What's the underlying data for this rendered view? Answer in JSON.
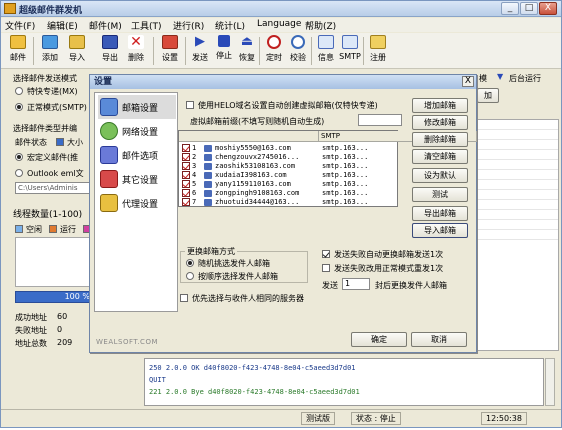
{
  "window": {
    "title": "超级邮件群发机",
    "minimize": "_",
    "maximize": "□",
    "close": "X"
  },
  "menu": [
    "文件(F)",
    "编辑(E)",
    "邮件(M)",
    "工具(T)",
    "进行(R)",
    "统计(L)",
    "Language",
    "帮助(Z)"
  ],
  "toolbar": {
    "items": [
      "邮件",
      "添加",
      "导入",
      "导出",
      "删除",
      "设置",
      "发送",
      "停止",
      "恢复",
      "定时",
      "校验",
      "信息",
      "SMTP",
      "注册"
    ]
  },
  "left": {
    "send_mode_label": "选择邮件发送模式",
    "mode_fast": "特快专递(MX)",
    "mode_normal": "正常模式(SMTP)",
    "mail_type_label": "选择邮件类型并编",
    "mail_status_label": "邮件状态",
    "mail_status_value": "大小",
    "macro_mail": "宏定义邮件(推",
    "outlook_file": "Outlook eml文",
    "path_value": "C:\\Users\\Adminis",
    "thread_count": "线程数量(1-100)",
    "legend_idle": "空闲",
    "legend_running": "运行",
    "progress_text": "100 %",
    "success_label": "成功地址",
    "success_value": "60",
    "fail_label": "失败地址",
    "fail_value": "0",
    "total_label": "地址总数",
    "total_value": "209"
  },
  "right_bg": {
    "tab_label": "模",
    "background_label": "后台运行",
    "add_label": "加"
  },
  "log": {
    "lines": [
      "250 2.0.0 OK d40f8020-f423-4748-8e04-c5aeed3d7d01",
      "QUIT",
      "221 2.0.0 Bye d40f8020-f423-4748-8e04-c5aeed3d7d01"
    ]
  },
  "status": {
    "edition": "测试版",
    "state": "状态 : 停止",
    "time": "12:50:38"
  },
  "dialog": {
    "title": "设置",
    "close": "X",
    "nav": [
      "邮箱设置",
      "网络设置",
      "邮件选项",
      "其它设置",
      "代理设置"
    ],
    "helo_checkbox": "使用HELO域名设置自动创建虚拟邮箱(仅特快专递)",
    "virtual_prefix_label": "虚拟邮箱前缀(不填写则随机自动生成)",
    "columns": [
      "",
      "SMTP"
    ],
    "rows": [
      {
        "num": "1",
        "email": "moshiy5550@163.com",
        "smtp": "smtp.163..."
      },
      {
        "num": "2",
        "email": "chengzouvx2745016...",
        "smtp": "smtp.163..."
      },
      {
        "num": "3",
        "email": "zaoshik53108163.com",
        "smtp": "smtp.163..."
      },
      {
        "num": "4",
        "email": "xudaiaI398163.com",
        "smtp": "smtp.163..."
      },
      {
        "num": "5",
        "email": "yany1159110163.com",
        "smtp": "smtp.163..."
      },
      {
        "num": "6",
        "email": "zongpingh9108163.com",
        "smtp": "smtp.163..."
      },
      {
        "num": "7",
        "email": "zhuotuid34444@163...",
        "smtp": "smtp.163..."
      }
    ],
    "buttons_right": [
      "增加邮箱",
      "修改邮箱",
      "删除邮箱",
      "清空邮箱",
      "设为默认",
      "测试",
      "导出邮箱",
      "导入邮箱"
    ],
    "switch_group_title": "更换邮箱方式",
    "switch_random": "随机挑选发件人邮箱",
    "switch_order": "按顺序选择发件人邮箱",
    "opt_fail_switch": "发送失败自动更换邮箱发送1次",
    "opt_fail_normal": "发送失败改用正常模式重发1次",
    "send_label": "发送",
    "send_count": "1",
    "send_suffix": "封后更换发件人邮箱",
    "prefer_same_server": "优先选择与收件人相同的服务器",
    "ok": "确定",
    "cancel": "取消",
    "watermark": "WEALSOFT.COM"
  }
}
